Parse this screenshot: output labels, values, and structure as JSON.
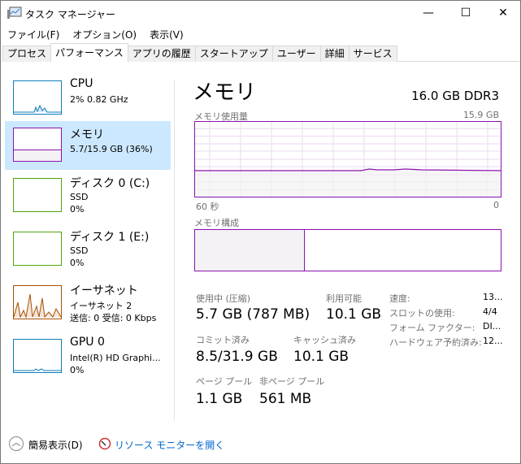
{
  "window": {
    "title": "タスク マネージャー",
    "minimize": "—",
    "maximize": "☐",
    "close": "✕"
  },
  "menu": [
    "ファイル(F)",
    "オプション(O)",
    "表示(V)"
  ],
  "tabs": [
    "プロセス",
    "パフォーマンス",
    "アプリの履歴",
    "スタートアップ",
    "ユーザー",
    "詳細",
    "サービス"
  ],
  "sidebar": [
    {
      "name": "CPU",
      "line1": "2%  0.82 GHz",
      "color": "#117dbb"
    },
    {
      "name": "メモリ",
      "line1": "5.7/15.9 GB (36%)",
      "color": "#8b12ae"
    },
    {
      "name": "ディスク 0 (C:)",
      "line1": "SSD",
      "line2": "0%",
      "color": "#4da60c"
    },
    {
      "name": "ディスク 1 (E:)",
      "line1": "SSD",
      "line2": "0%",
      "color": "#4da60c"
    },
    {
      "name": "イーサネット",
      "line1": "イーサネット 2",
      "line2": "送信: 0 受信: 0 Kbps",
      "color": "#a74f01"
    },
    {
      "name": "GPU 0",
      "line1": "Intel(R) HD Graphi...",
      "line2": "0%",
      "color": "#117dbb"
    }
  ],
  "main": {
    "title": "メモリ",
    "spec": "16.0 GB DDR3",
    "usage_label": "メモリ使用量",
    "usage_max": "15.9 GB",
    "time_label": "60 秒",
    "zero": "0",
    "composition_label": "メモリ構成",
    "in_use_fraction": 0.36,
    "stats": {
      "in_use_label": "使用中 (圧縮)",
      "in_use": "5.7 GB (787 MB)",
      "available_label": "利用可能",
      "available": "10.1 GB",
      "committed_label": "コミット済み",
      "committed": "8.5/31.9 GB",
      "cached_label": "キャッシュ済み",
      "cached": "10.1 GB",
      "paged_label": "ページ プール",
      "paged": "1.1 GB",
      "nonpaged_label": "非ページ プール",
      "nonpaged": "561 MB"
    },
    "details": [
      {
        "k": "速度:",
        "v": "13..."
      },
      {
        "k": "スロットの使用:",
        "v": "4/4"
      },
      {
        "k": "フォーム ファクター:",
        "v": "DI..."
      },
      {
        "k": "ハードウェア予約済み:",
        "v": "12..."
      }
    ]
  },
  "footer": {
    "fewer": "簡易表示(D)",
    "monitor": "リソース モニターを開く"
  }
}
